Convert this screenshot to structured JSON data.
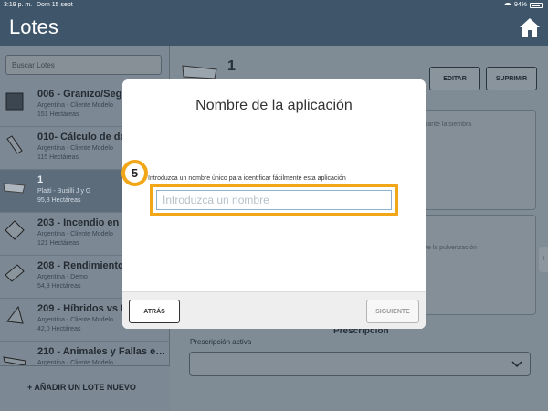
{
  "status": {
    "time": "3:19 p. m.",
    "date": "Dom 15 sept",
    "battery": "94%",
    "battery_level": 0.94
  },
  "nav": {
    "title": "Lotes",
    "home_icon": "home-icon"
  },
  "left": {
    "search_placeholder": "Buscar Lotes",
    "items": [
      {
        "name": "006 - Granizo/Seg",
        "sub": "Argentina - Cliente Modelo",
        "ha": "151 Hectáreas"
      },
      {
        "name": "010- Cálculo de da",
        "sub": "Argentina - Cliente Modelo",
        "ha": "115 Hectáreas"
      },
      {
        "name": "1",
        "sub": "Platti - Busilli J y G",
        "ha": "95,8 Hectáreas"
      },
      {
        "name": "203 - Incendio en",
        "sub": "Argentina - Cliente Modelo",
        "ha": "121 Hectáreas"
      },
      {
        "name": "208 - Rendimiento",
        "sub": "Argentina - Demo",
        "ha": "54,9 Hectáreas"
      },
      {
        "name": "209 - Híbridos vs F",
        "sub": "Argentina - Cliente Modelo",
        "ha": "42,0 Hectáreas"
      },
      {
        "name": "210 - Animales y Fallas e…",
        "sub": "Argentina - Cliente Modelo",
        "ha": ""
      }
    ],
    "add_label": "+ AÑADIR UN LOTE NUEVO"
  },
  "right": {
    "lote_number": "1",
    "edit_label": "EDITAR",
    "delete_label": "SUPRIMIR",
    "panel1_text": "rante la siembra",
    "panel2_text": "te la pulverización",
    "prescription_title": "Prescripción",
    "prescription_label": "Prescripción activa"
  },
  "modal": {
    "title": "Nombre de la aplicación",
    "instruction": "Introduzca un nombre único para identificar fácilmente esta aplicación",
    "input_placeholder": "Introduzca un nombre",
    "input_value": "",
    "back_label": "ATRÁS",
    "next_label": "SIGUIENTE"
  },
  "step_badge": "5",
  "colors": {
    "highlight": "#f2a718",
    "nav": "#3e556a"
  }
}
